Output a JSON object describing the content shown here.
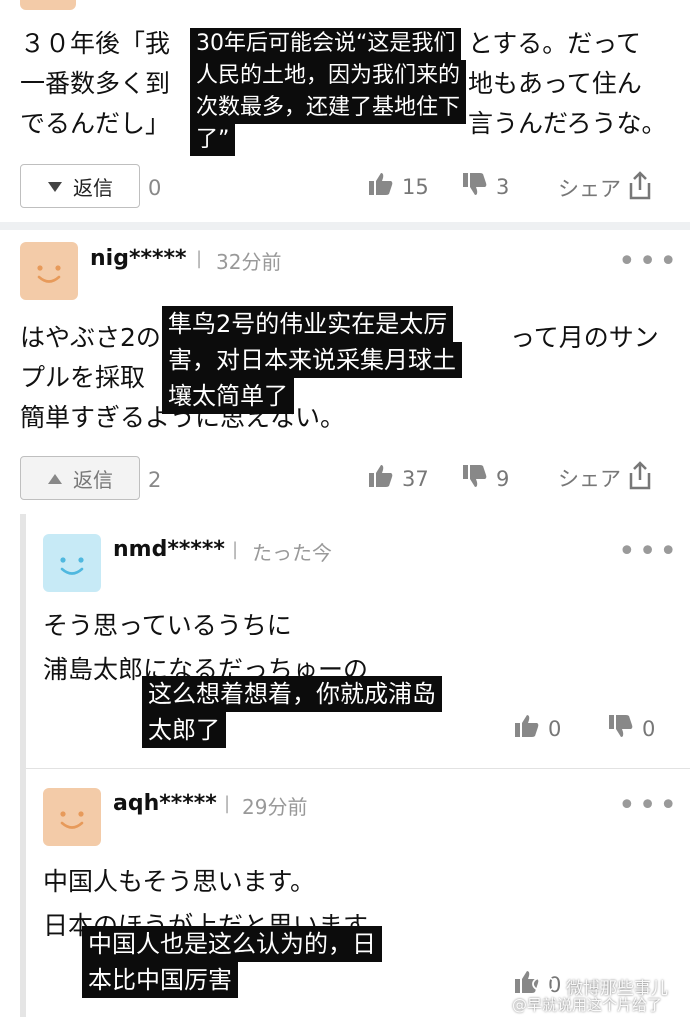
{
  "colors": {
    "avatar_orange": "#f3cba8",
    "avatar_blue": "#c7eaf6",
    "caption_bg": "#0c0c0c",
    "divider": "#eef0f2"
  },
  "top_comment": {
    "text_lines": [
      "３０年後「我",
      "一番数多く到",
      "でるんだし」"
    ],
    "text_lines_right": [
      "とする。だって",
      "地もあって住ん",
      "言うんだろうな。"
    ],
    "caption_lines": [
      "30年后可能会说“这是我们",
      "人民的土地，因为我们来的",
      "次数最多，还建了基地住下",
      "了”"
    ],
    "reply_label": "返信",
    "reply_count": "0",
    "like_count": "15",
    "dislike_count": "3",
    "share_label": "シェア"
  },
  "comment2": {
    "username": "nig*****",
    "separator": "|",
    "time": "32分前",
    "more": "•••",
    "text_lines": [
      "はやぶさ2の",
      "プルを採取",
      "簡単すぎるように思えない。"
    ],
    "text_lines_right": [
      "って月のサン"
    ],
    "caption_lines": [
      "隼鸟2号的伟业实在是太厉",
      "害，对日本来说采集月球土",
      "壤太简单了"
    ],
    "reply_label": "返信",
    "reply_count": "2",
    "like_count": "37",
    "dislike_count": "9",
    "share_label": "シェア"
  },
  "reply1": {
    "username": "nmd*****",
    "separator": "|",
    "time": "たった今",
    "more": "•••",
    "text_lines": [
      "そう思っているうちに",
      "浦島太郎になるだっちゅーの"
    ],
    "caption_lines": [
      "这么想着想着，你就成浦岛",
      "太郎了"
    ],
    "like_count": "0",
    "dislike_count": "0"
  },
  "reply2": {
    "username": "aqh*****",
    "separator": "|",
    "time": "29分前",
    "more": "•••",
    "text_lines": [
      "中国人もそう思います。",
      "日本のほうが上だと思います"
    ],
    "caption_lines": [
      "中国人也是这么认为的，日",
      "本比中国厉害"
    ],
    "like_count": "0",
    "dislike_count": "0"
  },
  "watermark": {
    "line1": "微博那些事儿",
    "line2": "@早就说用这个片给了"
  }
}
